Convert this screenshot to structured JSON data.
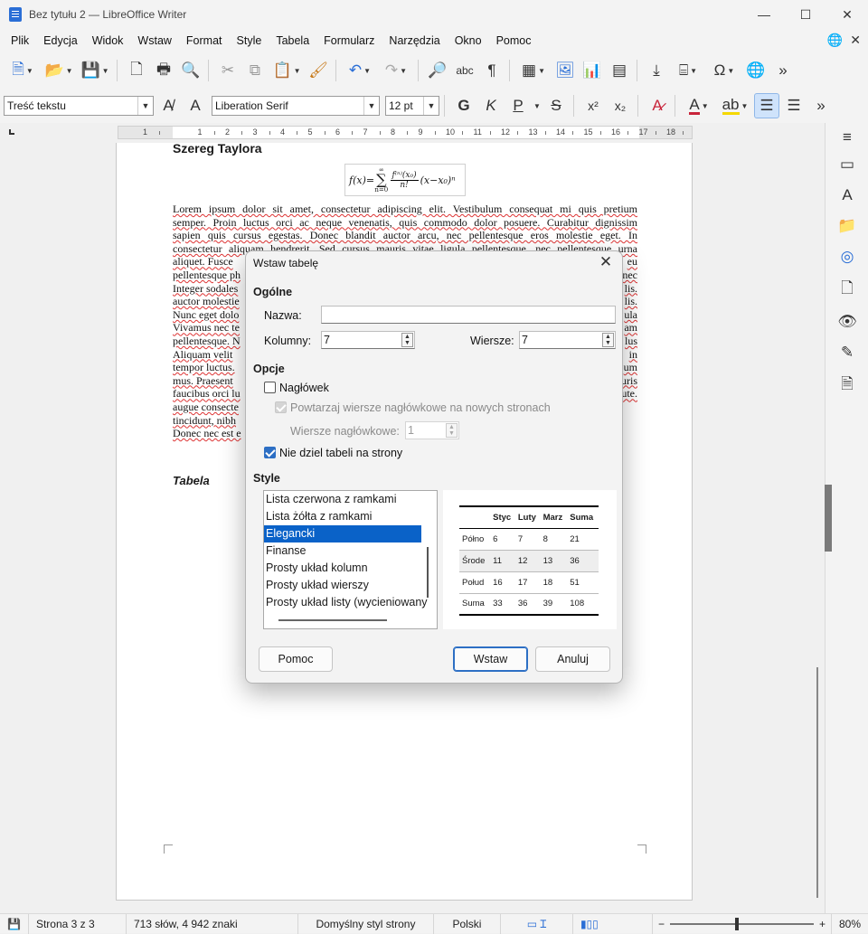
{
  "window": {
    "title": "Bez tytułu 2 — LibreOffice Writer",
    "controls": [
      "—",
      "☐",
      "✕"
    ]
  },
  "menu": [
    "Plik",
    "Edycja",
    "Widok",
    "Wstaw",
    "Format",
    "Style",
    "Tabela",
    "Formularz",
    "Narzędzia",
    "Okno",
    "Pomoc"
  ],
  "toolbar2": {
    "paragraph_style": "Treść tekstu",
    "font_name": "Liberation Serif",
    "font_size": "12 pt",
    "bold": "G",
    "italic": "K",
    "underline": "P",
    "strike": "S",
    "superscript": "x²",
    "subscript": "x₂"
  },
  "ruler": [
    "1",
    "1",
    "2",
    "3",
    "4",
    "5",
    "6",
    "7",
    "8",
    "9",
    "10",
    "11",
    "12",
    "13",
    "14",
    "15",
    "16",
    "17",
    "18"
  ],
  "document": {
    "heading": "Szereg Taylora",
    "formula": {
      "lhs": "f(x)=",
      "sum_top": "∞",
      "sum_bottom": "n=0",
      "numerator": "f⁽ⁿ⁾(x₀)",
      "denominator": "n!",
      "rhs": "(x−x₀)ⁿ"
    },
    "paragraph_lines": [
      "Lorem ipsum dolor sit amet, consectetur adipiscing elit. Vestibulum consequat mi quis pretium",
      "semper. Proin luctus orci ac neque venenatis, quis commodo dolor posuere. Curabitur dignissim",
      "sapien quis cursus egestas. Donec blandit auctor arcu, nec pellentesque eros molestie eget. In",
      "consectetur aliquam hendrerit. Sed cursus mauris vitae ligula pellentesque, nec pellentesque urna",
      "aliquet. Fusce",
      "pellentesque ph",
      "Integer sodales",
      "auctor molestie",
      "Nunc eget dolo",
      "Vivamus nec te",
      "pellentesque. N",
      "Aliquam velit",
      "tempor luctus.",
      "mus. Praesent",
      "faucibus orci lu",
      "augue consecte",
      "tincidunt, nibh",
      "Donec nec est e"
    ],
    "right_fragments": [
      "eu",
      "nec",
      "lis.",
      "lis.",
      "ula",
      "am",
      "lus",
      "in",
      "um",
      "uris",
      "ute."
    ],
    "section_label": "Tabela"
  },
  "dialog": {
    "title": "Wstaw tabelę",
    "close": "✕",
    "general_section": "Ogólne",
    "name_label": "Nazwa:",
    "name_value": "",
    "columns_label": "Kolumny:",
    "columns_value": "7",
    "rows_label": "Wiersze:",
    "rows_value": "7",
    "options_section": "Opcje",
    "heading_label": "Nagłówek",
    "repeat_label": "Powtarzaj wiersze nagłówkowe na nowych stronach",
    "heading_rows_label": "Wiersze nagłówkowe:",
    "heading_rows_value": "1",
    "dont_split_label": "Nie dziel tabeli na strony",
    "style_section": "Style",
    "styles": [
      "Lista czerwona z ramkami",
      "Lista żółta z ramkami",
      "Elegancki",
      "Finanse",
      "Prosty układ kolumn",
      "Prosty układ wierszy",
      "Prosty układ listy (wycieniowany"
    ],
    "selected_style": "Elegancki",
    "preview": {
      "header": [
        "",
        "Styc",
        "Luty",
        "Marz",
        "Suma"
      ],
      "rows": [
        [
          "Półno",
          "6",
          "7",
          "8",
          "21"
        ],
        [
          "Środe",
          "11",
          "12",
          "13",
          "36"
        ],
        [
          "Połud",
          "16",
          "17",
          "18",
          "51"
        ],
        [
          "Suma",
          "33",
          "36",
          "39",
          "108"
        ]
      ]
    },
    "help_button": "Pomoc",
    "insert_button": "Wstaw",
    "cancel_button": "Anuluj"
  },
  "status": {
    "page": "Strona 3 z 3",
    "words": "713 słów, 4 942 znaki",
    "page_style": "Domyślny styl strony",
    "language": "Polski",
    "zoom": "80%"
  }
}
